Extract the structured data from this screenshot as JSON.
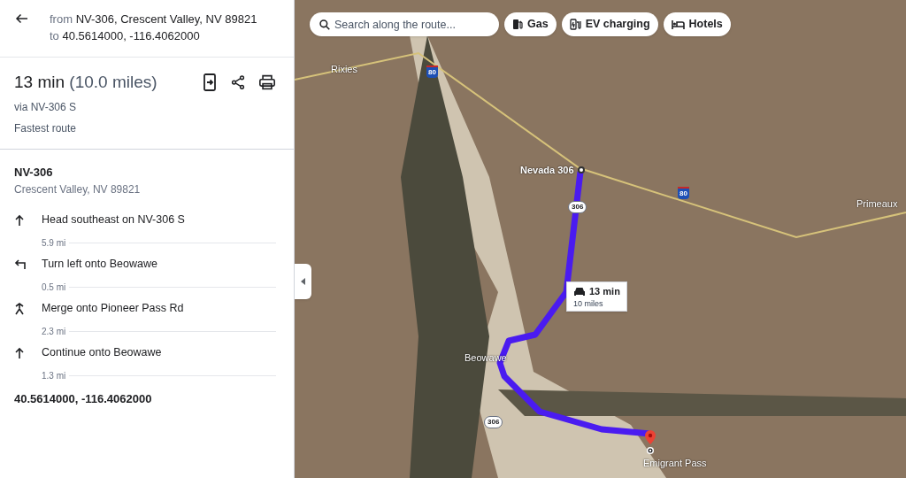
{
  "header": {
    "from_label": "from",
    "from": "NV-306, Crescent Valley, NV 89821",
    "to_label": "to",
    "to": "40.5614000, -116.4062000"
  },
  "summary": {
    "time": "13 min",
    "distance": "(10.0 miles)",
    "via": "via NV-306 S",
    "note": "Fastest route"
  },
  "origin": {
    "name": "NV-306",
    "address": "Crescent Valley, NV 89821"
  },
  "steps": [
    {
      "kind": "straight",
      "text": "Head southeast on NV-306 S",
      "distance": "5.9 mi"
    },
    {
      "kind": "left",
      "text": "Turn left onto Beowawe",
      "distance": "0.5 mi"
    },
    {
      "kind": "merge",
      "text": "Merge onto Pioneer Pass Rd",
      "distance": "2.3 mi"
    },
    {
      "kind": "straight",
      "text": "Continue onto Beowawe",
      "distance": "1.3 mi"
    }
  ],
  "destination": "40.5614000, -116.4062000",
  "map": {
    "search": {
      "placeholder": "Search along the route..."
    },
    "chips": [
      {
        "kind": "gas",
        "label": "Gas"
      },
      {
        "kind": "ev",
        "label": "EV charging"
      },
      {
        "kind": "hotel",
        "label": "Hotels"
      }
    ],
    "places": [
      {
        "kind": "town",
        "label": "Rixies"
      },
      {
        "kind": "start",
        "label": "Nevada 306"
      },
      {
        "kind": "town",
        "label": "Primeaux"
      },
      {
        "kind": "town",
        "label": "Beowawe"
      },
      {
        "kind": "town",
        "label": "Emigrant Pass"
      }
    ],
    "shields": [
      {
        "kind": "interstate",
        "label": "80"
      },
      {
        "kind": "interstate",
        "label": "80"
      },
      {
        "kind": "state",
        "label": "306"
      },
      {
        "kind": "state",
        "label": "306"
      }
    ],
    "route_box": {
      "time": "13 min",
      "distance": "10 miles"
    }
  }
}
